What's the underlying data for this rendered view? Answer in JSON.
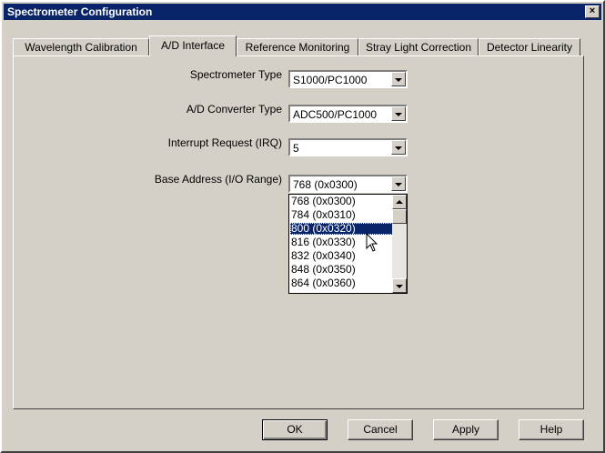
{
  "window": {
    "title": "Spectrometer Configuration",
    "close_glyph": "×"
  },
  "tabs": [
    {
      "label": "Wavelength Calibration",
      "active": false
    },
    {
      "label": "A/D Interface",
      "active": true
    },
    {
      "label": "Reference Monitoring",
      "active": false
    },
    {
      "label": "Stray Light Correction",
      "active": false
    },
    {
      "label": "Detector Linearity",
      "active": false
    }
  ],
  "form": {
    "spectrometer_type": {
      "label": "Spectrometer Type",
      "value": "S1000/PC1000"
    },
    "ad_converter_type": {
      "label": "A/D Converter Type",
      "value": "ADC500/PC1000"
    },
    "irq": {
      "label": "Interrupt Request (IRQ)",
      "value": "5"
    },
    "base_address": {
      "label": "Base Address (I/O Range)",
      "value": "768 (0x0300)"
    }
  },
  "base_address_options": [
    "768 (0x0300)",
    "784 (0x0310)",
    "800 (0x0320)",
    "816 (0x0330)",
    "832 (0x0340)",
    "848 (0x0350)",
    "864 (0x0360)"
  ],
  "highlighted_option_index": 2,
  "buttons": {
    "ok": "OK",
    "cancel": "Cancel",
    "apply": "Apply",
    "help": "Help"
  },
  "colors": {
    "titlebar": "#0a246a",
    "face": "#d4d0c8",
    "selection": "#0a246a"
  }
}
